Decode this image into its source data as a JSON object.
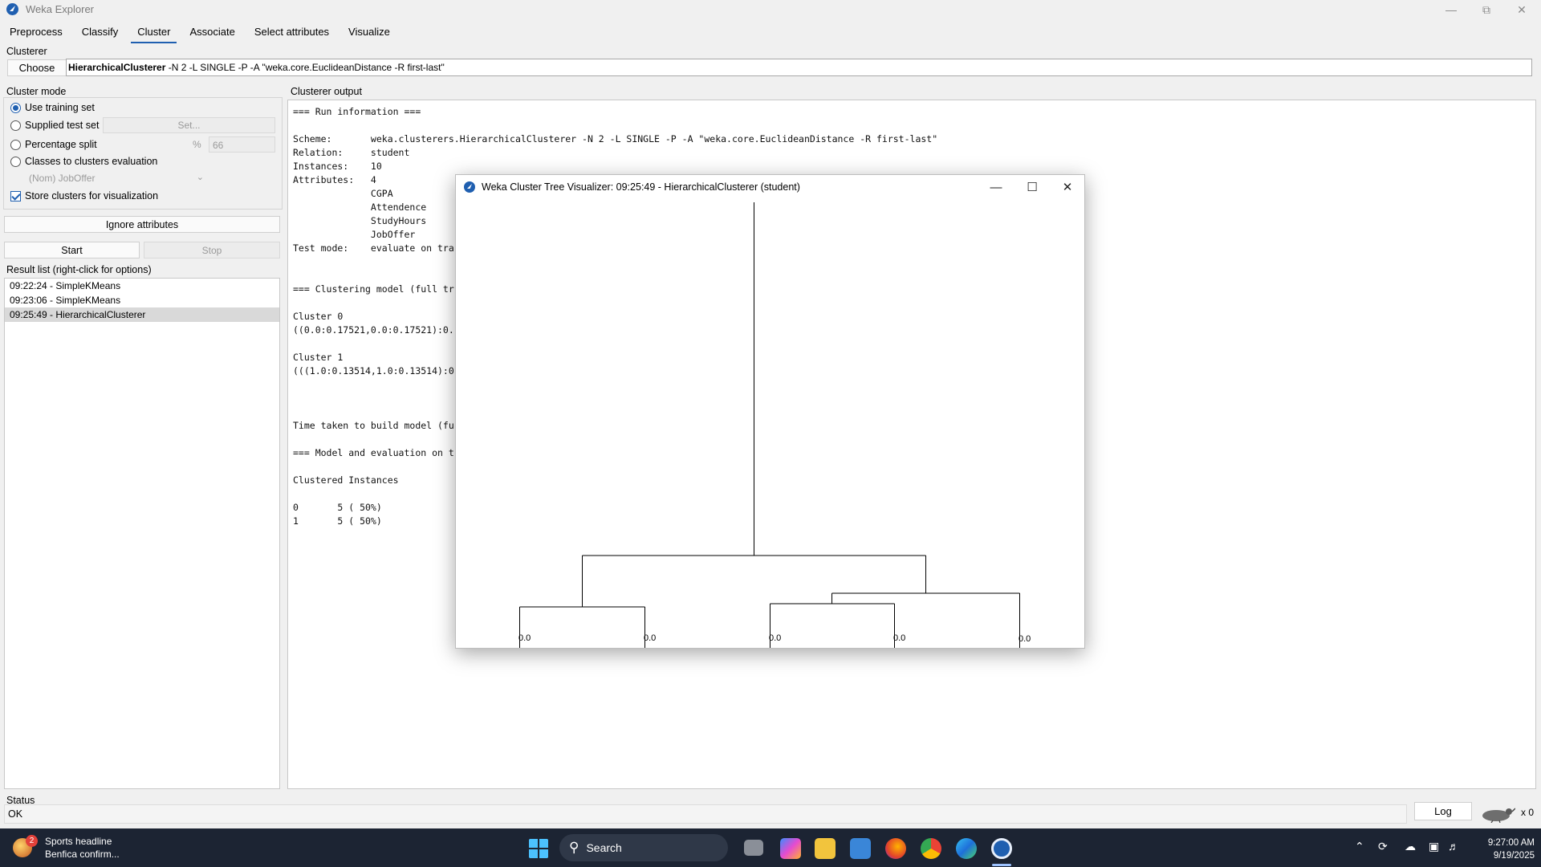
{
  "window": {
    "title": "Weka Explorer"
  },
  "tabs": [
    "Preprocess",
    "Classify",
    "Cluster",
    "Associate",
    "Select attributes",
    "Visualize"
  ],
  "active_tab": "Cluster",
  "clusterer": {
    "section_label": "Clusterer",
    "choose_label": "Choose",
    "name": "HierarchicalClusterer",
    "options": " -N 2 -L SINGLE -P -A \"weka.core.EuclideanDistance -R first-last\""
  },
  "cluster_mode": {
    "label": "Cluster mode",
    "use_training_set": "Use training set",
    "supplied_test_set": "Supplied test set",
    "set_button": "Set...",
    "percentage_split": "Percentage split",
    "percent_symbol": "%",
    "percent_value": "66",
    "classes_to_clusters": "Classes to clusters evaluation",
    "class_attribute": "(Nom) JobOffer",
    "store_clusters": "Store clusters for visualization",
    "selected": "Use training set",
    "store_checked": true
  },
  "buttons": {
    "ignore_attributes": "Ignore attributes",
    "start": "Start",
    "stop": "Stop"
  },
  "result_list": {
    "label": "Result list (right-click for options)",
    "items": [
      "09:22:24 - SimpleKMeans",
      "09:23:06 - SimpleKMeans",
      "09:25:49 - HierarchicalClusterer"
    ],
    "selected_index": 2
  },
  "output": {
    "label": "Clusterer output",
    "lines": [
      "=== Run information ===",
      "",
      "Scheme:       weka.clusterers.HierarchicalClusterer -N 2 -L SINGLE -P -A \"weka.core.EuclideanDistance -R first-last\"",
      "Relation:     student",
      "Instances:    10",
      "Attributes:   4",
      "              CGPA",
      "              Attendence",
      "              StudyHours",
      "              JobOffer",
      "Test mode:    evaluate on tra",
      "",
      "",
      "=== Clustering model (full tr",
      "",
      "Cluster 0",
      "((0.0:0.17521,0.0:0.17521):0.",
      "",
      "Cluster 1",
      "(((1.0:0.13514,1.0:0.13514):0",
      "",
      "",
      "",
      "Time taken to build model (fu",
      "",
      "=== Model and evaluation on t",
      "",
      "Clustered Instances",
      "",
      "0       5 ( 50%)",
      "1       5 ( 50%)"
    ]
  },
  "status": {
    "label": "Status",
    "value": "OK",
    "log_button": "Log",
    "count": "x 0"
  },
  "popup": {
    "title": "Weka Cluster Tree Visualizer: 09:25:49 - HierarchicalClusterer (student)",
    "leaf_labels": [
      "0.0",
      "0.0",
      "0.0",
      "0.0",
      "0.0"
    ]
  },
  "taskbar": {
    "news_title": "Sports headline",
    "news_subtitle": "Benfica confirm...",
    "news_badge": "2",
    "search_placeholder": "Search",
    "time": "9:27:00 AM",
    "date": "9/19/2025"
  }
}
